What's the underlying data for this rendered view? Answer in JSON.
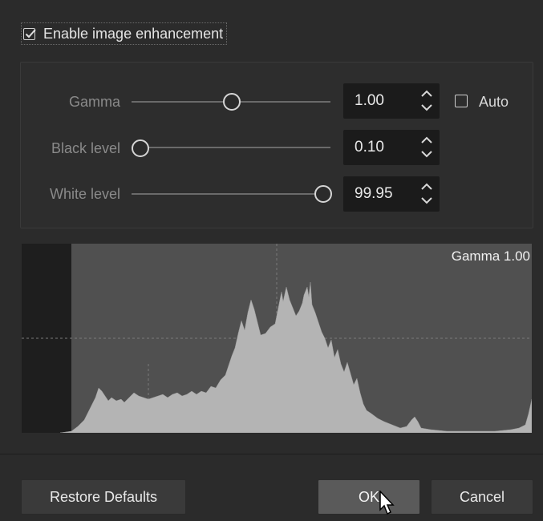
{
  "enhancement": {
    "enabled": true,
    "label": "Enable image enhancement"
  },
  "controls": {
    "gamma": {
      "label": "Gamma",
      "value": "1.00",
      "slider_fraction": 0.5
    },
    "black_level": {
      "label": "Black level",
      "value": "0.10",
      "slider_fraction": 0.0
    },
    "white_level": {
      "label": "White level",
      "value": "99.95",
      "slider_fraction": 1.0
    },
    "auto": {
      "label": "Auto",
      "checked": false
    }
  },
  "histogram": {
    "label": "Gamma 1.00"
  },
  "buttons": {
    "restore_defaults": "Restore Defaults",
    "ok": "OK",
    "cancel": "Cancel"
  },
  "colors": {
    "background": "#2b2b2b",
    "histogram_fill": "#b4b4b4",
    "histogram_bg": "#505050"
  }
}
